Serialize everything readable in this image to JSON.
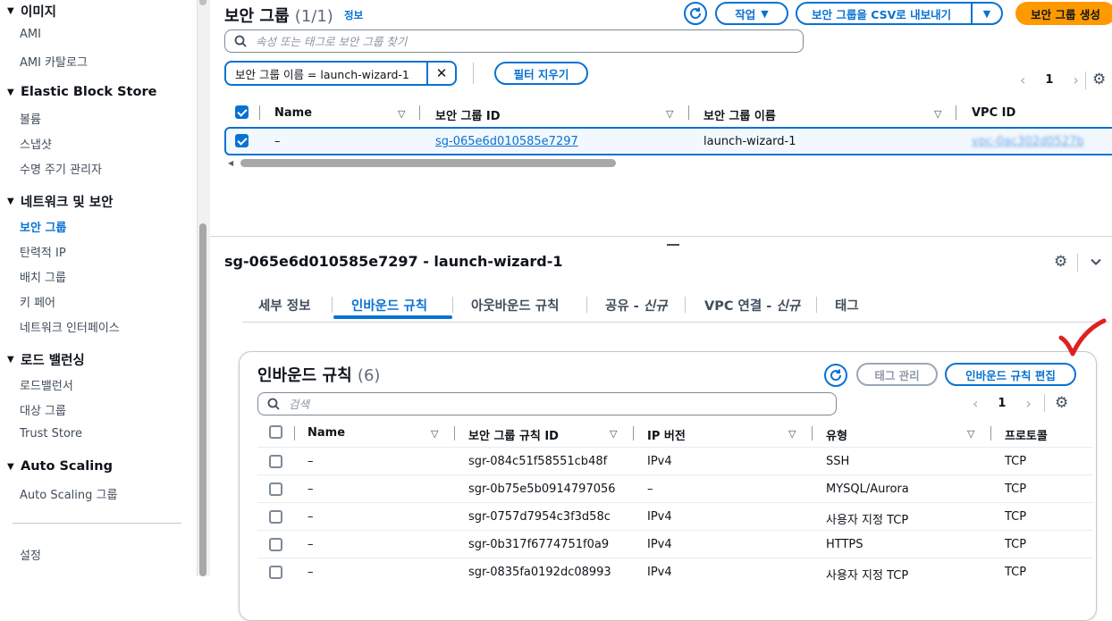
{
  "sidebar": {
    "sections": [
      {
        "label": "이미지",
        "items": [
          "AMI",
          "AMI 카탈로그"
        ]
      },
      {
        "label": "Elastic Block Store",
        "items": [
          "볼륨",
          "스냅샷",
          "수명 주기 관리자"
        ]
      },
      {
        "label": "네트워크 및 보안",
        "items": [
          "보안 그룹",
          "탄력적 IP",
          "배치 그룹",
          "키 페어",
          "네트워크 인터페이스"
        ]
      },
      {
        "label": "로드 밸런싱",
        "items": [
          "로드밸런서",
          "대상 그룹",
          "Trust Store"
        ]
      },
      {
        "label": "Auto Scaling",
        "items": [
          "Auto Scaling 그룹"
        ]
      }
    ],
    "active_item": "보안 그룹",
    "settings": "설정"
  },
  "header": {
    "title": "보안 그룹",
    "count": "(1/1)",
    "info": "정보",
    "actions_label": "작업",
    "export_label": "보안 그룹을 CSV로 내보내기",
    "create_label": "보안 그룹 생성"
  },
  "search": {
    "placeholder": "속성 또는 태그로 보안 그룹 찾기"
  },
  "filter": {
    "token": "보안 그룹 이름 = launch-wizard-1",
    "clear_label": "필터 지우기"
  },
  "pagination": {
    "page": "1"
  },
  "table": {
    "columns": [
      "Name",
      "보안 그룹 ID",
      "보안 그룹 이름",
      "VPC ID"
    ],
    "rows": [
      {
        "name": "–",
        "id": "sg-065e6d010585e7297",
        "group_name": "launch-wizard-1",
        "vpc_id": "vpc-0ac302d0527b"
      }
    ]
  },
  "detail": {
    "title": "sg-065e6d010585e7297 - launch-wizard-1",
    "tabs": [
      {
        "label": "세부 정보"
      },
      {
        "label": "인바운드 규칙"
      },
      {
        "label": "아웃바운드 규칙"
      },
      {
        "label": "공유 - ",
        "em": "신규"
      },
      {
        "label": "VPC 연결 - ",
        "em": "신규"
      },
      {
        "label": "태그"
      }
    ],
    "active_tab": "인바운드 규칙"
  },
  "inbound": {
    "title": "인바운드 규칙",
    "count": "(6)",
    "manage_tags_label": "태그 관리",
    "edit_label": "인바운드 규칙 편집",
    "search_placeholder": "검색",
    "page": "1",
    "columns": [
      "Name",
      "보안 그룹 규칙 ID",
      "IP 버전",
      "유형",
      "프로토콜"
    ],
    "rows": [
      {
        "name": "–",
        "rule_id": "sgr-084c51f58551cb48f",
        "ip": "IPv4",
        "type": "SSH",
        "protocol": "TCP"
      },
      {
        "name": "–",
        "rule_id": "sgr-0b75e5b0914797056",
        "ip": "–",
        "type": "MYSQL/Aurora",
        "protocol": "TCP"
      },
      {
        "name": "–",
        "rule_id": "sgr-0757d7954c3f3d58c",
        "ip": "IPv4",
        "type": "사용자 지정 TCP",
        "protocol": "TCP"
      },
      {
        "name": "–",
        "rule_id": "sgr-0b317f6774751f0a9",
        "ip": "IPv4",
        "type": "HTTPS",
        "protocol": "TCP"
      },
      {
        "name": "–",
        "rule_id": "sgr-0835fa0192dc08993",
        "ip": "IPv4",
        "type": "사용자 지정 TCP",
        "protocol": "TCP"
      }
    ]
  },
  "colors": {
    "accent": "#0972d3",
    "primary": "#ff9900",
    "annotation": "#e02020"
  }
}
